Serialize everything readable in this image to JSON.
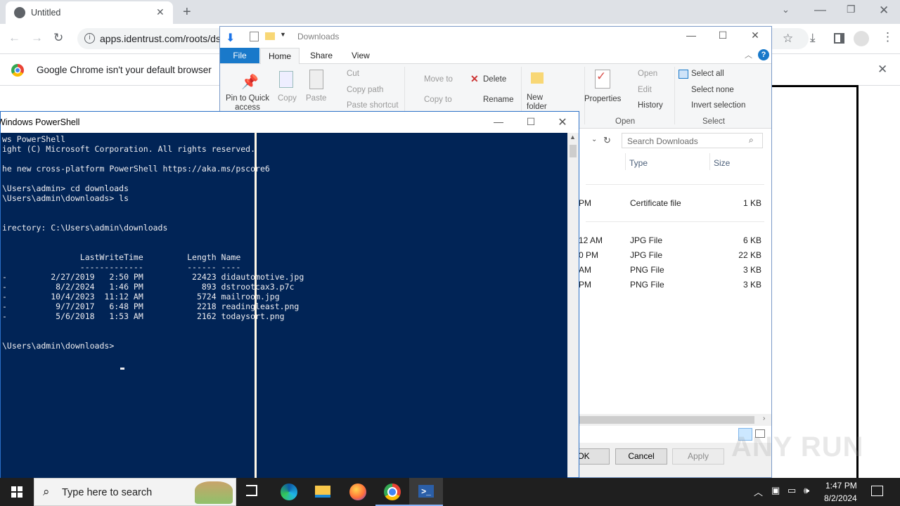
{
  "chrome": {
    "tab_title": "Untitled",
    "url": "apps.identrust.com/roots/ds",
    "infobar_text": "Google Chrome isn't your default browser"
  },
  "explorer": {
    "title": "Downloads",
    "tabs": [
      "File",
      "Home",
      "Share",
      "View"
    ],
    "ribbon": {
      "pin": "Pin to Quick access",
      "copy": "Copy",
      "paste": "Paste",
      "cut": "Cut",
      "copy_path": "Copy path",
      "paste_shortcut": "Paste shortcut",
      "move_to": "Move to",
      "copy_to": "Copy to",
      "delete": "Delete",
      "rename": "Rename",
      "new_folder": "New folder",
      "properties": "Properties",
      "open": "Open",
      "edit": "Edit",
      "history": "History",
      "select_all": "Select all",
      "select_none": "Select none",
      "invert_selection": "Invert selection",
      "group_open": "Open",
      "group_select": "Select"
    },
    "search_placeholder": "Search Downloads",
    "columns": {
      "type": "Type",
      "size": "Size"
    },
    "rows": [
      {
        "date_fragment": "PM",
        "type": "Certificate file",
        "size": "1 KB"
      },
      {
        "date_fragment": "12 AM",
        "type": "JPG File",
        "size": "6 KB"
      },
      {
        "date_fragment": "0 PM",
        "type": "JPG File",
        "size": "22 KB"
      },
      {
        "date_fragment": "AM",
        "type": "PNG File",
        "size": "3 KB"
      },
      {
        "date_fragment": "PM",
        "type": "PNG File",
        "size": "3 KB"
      }
    ],
    "dialog_buttons": {
      "ok": "OK",
      "cancel": "Cancel",
      "apply": "Apply"
    }
  },
  "powershell": {
    "title": "Windows PowerShell",
    "lines": [
      "ws PowerShell",
      "ight (C) Microsoft Corporation. All rights reserved.",
      "",
      "he new cross-platform PowerShell https://aka.ms/pscore6",
      "",
      "\\Users\\admin> cd downloads",
      "\\Users\\admin\\downloads> ls",
      "",
      "",
      "irectory: C:\\Users\\admin\\downloads",
      "",
      "",
      "                LastWriteTime         Length Name",
      "                -------------         ------ ----",
      "-         2/27/2019   2:50 PM          22423 didautomotive.jpg",
      "-          8/2/2024   1:46 PM            893 dstrootcax3.p7c",
      "-         10/4/2023  11:12 AM           5724 mailroom.jpg",
      "-          9/7/2017   6:48 PM           2218 readingleast.png",
      "-          5/6/2018   1:53 AM           2162 todaysort.png",
      "",
      "",
      "\\Users\\admin\\downloads> "
    ]
  },
  "taskbar": {
    "search_placeholder": "Type here to search",
    "time": "1:47 PM",
    "date": "8/2/2024"
  },
  "watermark": "ANY RUN"
}
